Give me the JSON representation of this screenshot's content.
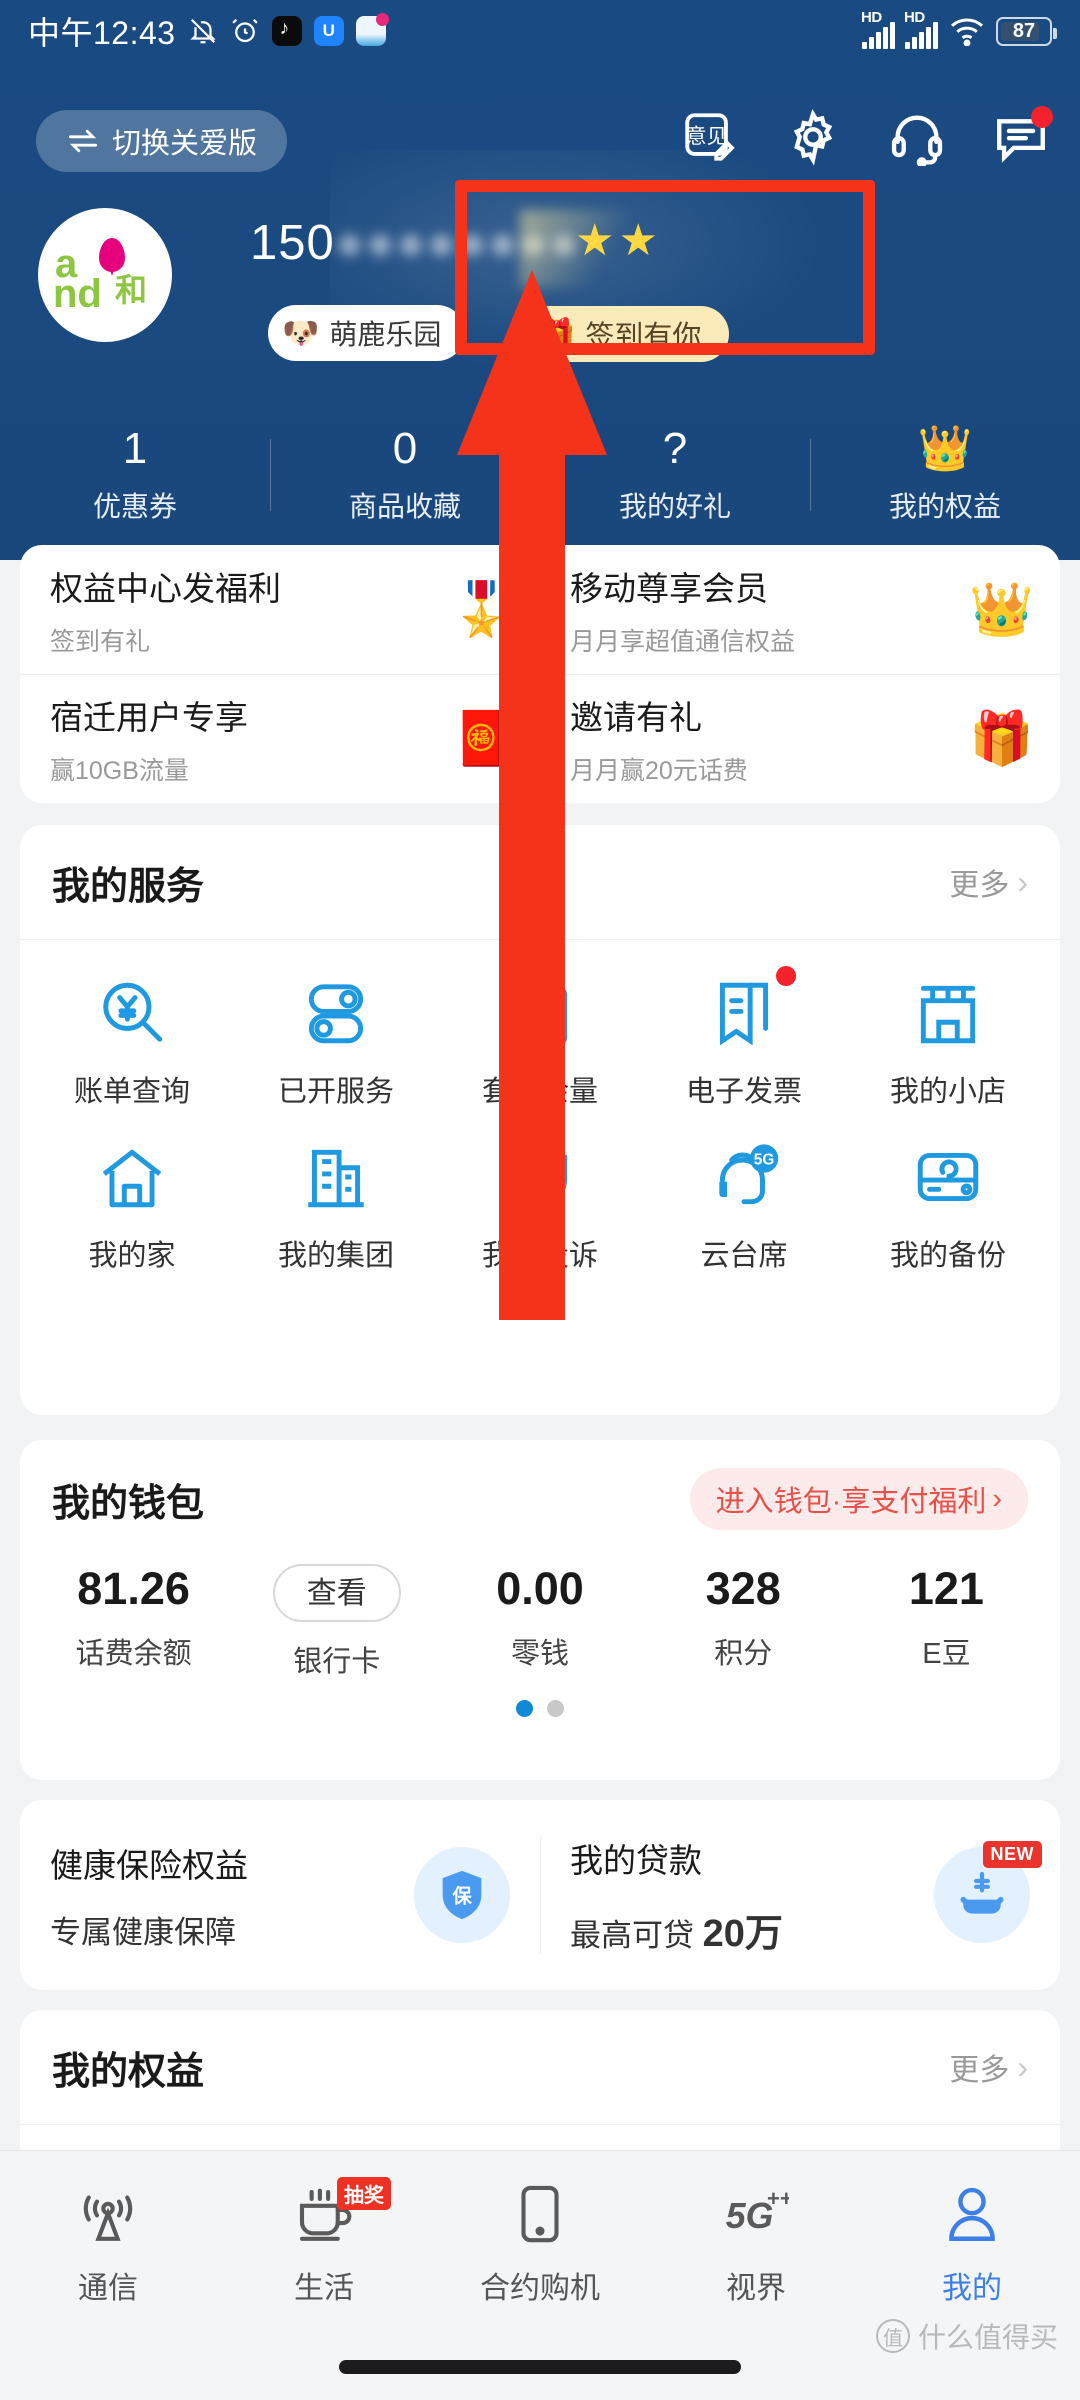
{
  "status_bar": {
    "time": "中午12:43",
    "icons": [
      "mute-icon",
      "alarm-icon",
      "tiktok-app-icon",
      "blue-app-icon",
      "cmcc-app-icon"
    ],
    "signal_label_1": "HD",
    "signal_label_2": "HD",
    "wifi": "wifi-icon",
    "battery": "87"
  },
  "header": {
    "care_version_button": "切换关爱版",
    "care_version_icon": "swap-icon",
    "actions": [
      {
        "name": "feedback-icon",
        "label": "意见"
      },
      {
        "name": "settings-gear-icon",
        "label": ""
      },
      {
        "name": "headset-support-icon",
        "label": ""
      },
      {
        "name": "message-icon",
        "label": "",
        "badge": true
      }
    ],
    "avatar_logo_text": {
      "a": "a",
      "nd": "nd",
      "he": "和"
    },
    "phone_number": "150",
    "phone_number_masked": "●●●●●●●●",
    "user_tag": "萌鹿乐园",
    "user_tag_emoji": "🐶",
    "stars": "★★",
    "signin_button": "签到有你",
    "signin_icon": "gift-icon"
  },
  "stats": [
    {
      "value": "1",
      "label": "优惠券"
    },
    {
      "value": "0",
      "label": "商品收藏"
    },
    {
      "value": "?",
      "label": "我的好礼"
    },
    {
      "value": "👑",
      "label": "我的权益"
    }
  ],
  "benefits": [
    {
      "title": "权益中心发福利",
      "subtitle": "签到有礼",
      "icon": "medal-icon"
    },
    {
      "title": "移动尊享会员",
      "subtitle": "月月享超值通信权益",
      "icon": "crown-icon"
    },
    {
      "title": "宿迁用户专享",
      "subtitle": "赢10GB流量",
      "icon": "redpacket-icon"
    },
    {
      "title": "邀请有礼",
      "subtitle": "月月赢20元话费",
      "icon": "gift-box-icon"
    }
  ],
  "services": {
    "title": "我的服务",
    "more": "更多",
    "items": [
      {
        "label": "账单查询",
        "icon": "bill-search-icon",
        "badge": false
      },
      {
        "label": "已开服务",
        "icon": "toggle-services-icon",
        "badge": false
      },
      {
        "label": "套餐余量",
        "icon": "plan-balance-icon",
        "badge": false
      },
      {
        "label": "电子发票",
        "icon": "e-invoice-icon",
        "badge": true
      },
      {
        "label": "我的小店",
        "icon": "my-store-icon",
        "badge": false
      },
      {
        "label": "我的家",
        "icon": "home-icon",
        "badge": false
      },
      {
        "label": "我的集团",
        "icon": "group-building-icon",
        "badge": false
      },
      {
        "label": "我的投诉",
        "icon": "complaint-shield-icon",
        "badge": false
      },
      {
        "label": "云台席",
        "icon": "cloud-agent-5g-icon",
        "badge": false
      },
      {
        "label": "我的备份",
        "icon": "backup-icon",
        "badge": false
      }
    ],
    "pagination": {
      "total": 2,
      "active": 0
    }
  },
  "wallet": {
    "title": "我的钱包",
    "cta": "进入钱包·享支付福利",
    "items": [
      {
        "value": "81.26",
        "label": "话费余额",
        "is_button": false
      },
      {
        "value": "查看",
        "label": "银行卡",
        "is_button": true
      },
      {
        "value": "0.00",
        "label": "零钱",
        "is_button": false
      },
      {
        "value": "328",
        "label": "积分",
        "is_button": false
      },
      {
        "value": "121",
        "label": "E豆",
        "is_button": false
      }
    ],
    "pagination": {
      "total": 2,
      "active": 0
    }
  },
  "finance": [
    {
      "title": "健康保险权益",
      "subtitle": "专属健康保障",
      "icon": "insurance-shield-icon",
      "badge": ""
    },
    {
      "title": "我的贷款",
      "subtitle_prefix": "最高可贷",
      "subtitle_amount": "20万",
      "icon": "loan-icon",
      "badge": "NEW"
    }
  ],
  "rights": {
    "title": "我的权益",
    "more": "更多"
  },
  "tabbar": [
    {
      "label": "通信",
      "icon": "signal-tower-icon",
      "active": false,
      "badge": ""
    },
    {
      "label": "生活",
      "icon": "cup-icon",
      "active": false,
      "badge": "抽奖"
    },
    {
      "label": "合约购机",
      "icon": "phone-device-icon",
      "active": false,
      "badge": ""
    },
    {
      "label": "视界",
      "icon": "5g-plus-icon",
      "active": false,
      "badge": ""
    },
    {
      "label": "我的",
      "icon": "person-icon",
      "active": true,
      "badge": ""
    }
  ],
  "watermark": "什么值得买",
  "colors": {
    "hero_blue": "#1b4a80",
    "accent_blue": "#1f9ae0",
    "tab_active": "#3d7fe8",
    "badge_red": "#f5222d",
    "highlight_red": "#f4331a",
    "signin_yellow": "#fbeaba",
    "wallet_cta_bg": "#fdeaea",
    "wallet_cta_text": "#e8504a"
  }
}
